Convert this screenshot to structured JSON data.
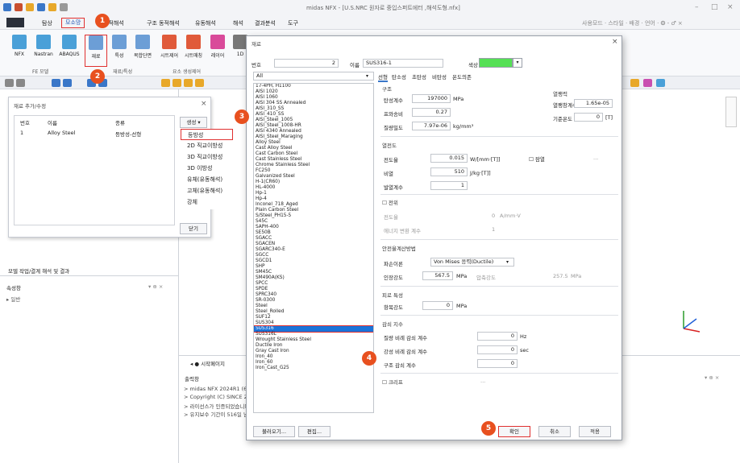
{
  "app": {
    "title": "midas NFX - [U.S.NRC 원자로 중입스퍼트에터 ,해석도형.nfx]",
    "right_tools": "사용모드 · 스타일 · 배경 · 언어 · ❂ - ♂ ×"
  },
  "menu": [
    "탐상",
    "모소망",
    "정적해석",
    "구조 동적해석",
    "유동해석",
    "해석",
    "결과분석",
    "도구"
  ],
  "ribbon": {
    "buttons": [
      "NFX",
      "Nastran",
      "ABAQUS",
      "재료",
      "특성",
      "복합단면",
      "시트제어",
      "시트매칭",
      "레이어",
      "1D"
    ],
    "groups": [
      "FE 모델",
      "재료/특성",
      "요소 생성제어"
    ]
  },
  "markers": [
    "1",
    "2",
    "3",
    "4",
    "5"
  ],
  "matwin": {
    "title": "재료 추가/수정",
    "headers": [
      "번호",
      "이름",
      "종류"
    ],
    "row": {
      "no": "1",
      "name": "Alloy Steel",
      "kind": "등방성-선형"
    },
    "create_btn": "생성",
    "close_btn": "닫기"
  },
  "create_menu": [
    "등방성",
    "2D 직교이방성",
    "3D 직교이방성",
    "3D 이방성",
    "유체(유동해석)",
    "고체(유동해석)",
    "강체"
  ],
  "left_tabs": "모델  작업/결계  해석 및 결과",
  "prop_panel": {
    "title": "속성창",
    "item": "일반"
  },
  "bottom": {
    "tab": "시작페이지",
    "output_title": "출력창",
    "lines": [
      "> midas NFX 2024R1 (64bi",
      "> Copyright (C) SINCE 200",
      "> 라이선스가 인증되었습니다",
      "> 유지보수 기간이 516일 남"
    ]
  },
  "dlg": {
    "title": "재료",
    "no_label": "번호",
    "no": "2",
    "name_label": "이름",
    "name": "SUS316-1",
    "color_label": "색상",
    "color": "#55e055",
    "filter": "All",
    "tabs": [
      "선형",
      "탄소성",
      "초탄성",
      "비탄성",
      "온도의존"
    ],
    "list": [
      "17-4PH, H1100",
      "AISI 1020",
      "AISI 1060",
      "AISI 304 SS Annealed",
      "AISI_310_SS",
      "AISI_410_SS",
      "AISI_Steel_1005",
      "AISI_Steel_1008-HR",
      "AISI 4340 Annealed",
      "AISI_Steel_Maraging",
      "Alloy Steel",
      "Cast Alloy Steel",
      "Cast Carbon Steel",
      "Cast Stainless Steel",
      "Chrome Stainless Steel",
      "FC250",
      "Galvanized Steel",
      "H-1(CR60)",
      "HL-4000",
      "Hp-1",
      "Hp-4",
      "Inconel_718_Aged",
      "Plain Carbon Steel",
      "S/Steel_PH15-5",
      "S45C",
      "SAPH-400",
      "SE50B",
      "SGACC",
      "SGACEN",
      "SGARC340-E",
      "SGCC",
      "SGCD1",
      "SHP",
      "SM45C",
      "SM490A(KS)",
      "SPCC",
      "SPDE",
      "SPRC340",
      "SR-0300",
      "Steel",
      "Steel_Rolled",
      "SUF12",
      "SUS304",
      "SUS316",
      "SUS316L",
      "Wrought Stainless Steel",
      "Ductile Iron",
      "Gray Cast Iron",
      "Iron_40",
      "Iron_60",
      "Iron_Cast_G25"
    ],
    "selected": "SUS316",
    "struct": {
      "title": "구조",
      "e_label": "탄성계수",
      "e": "197000",
      "e_unit": "MPa",
      "nu_label": "프와송비",
      "nu": "0.27",
      "rho_label": "질량밀도",
      "rho": "7.97e-06",
      "rho_unit": "kg/mm³",
      "thermal_title": "열팽력",
      "alpha_label": "열팽창계수",
      "alpha": "1.65e-05",
      "tref_label": "기준온도",
      "tref": "0",
      "tref_unit": "[T]"
    },
    "heat": {
      "title": "열전도",
      "k_label": "전도율",
      "k": "0.015",
      "k_unit": "W/[mm·[T]]",
      "c_label": "비열",
      "c": "510",
      "c_unit": "J/kg·[T]]",
      "h_label": "발열계수",
      "h": "1",
      "latent": "잠열"
    },
    "elec": {
      "title": "전위",
      "cond_label": "전도율",
      "cond": "0",
      "cond_unit": "A/mm·V",
      "coef_label": "에너지 변환 계수",
      "coef": "1"
    },
    "safety": {
      "title": "안전율계산방법",
      "crit_label": "파손이론",
      "crit": "Von Mises 응력(Ductile)",
      "yield_label": "인장강도",
      "yield": "567.5",
      "yield_unit": "MPa",
      "comp_label": "압축강도",
      "comp": "257.5",
      "comp_unit": "MPa"
    },
    "fatigue": {
      "title": "피로 특성",
      "label": "항복강도",
      "value": "0",
      "unit": "MPa"
    },
    "damp": {
      "title": "감쇠 지수",
      "m_label": "질량 비례 감쇠 계수",
      "m": "0",
      "m_unit": "Hz",
      "k_label": "강성 비례 감쇠 계수",
      "k": "0",
      "k_unit": "sec",
      "s_label": "구조 감쇠 계수",
      "s": "0"
    },
    "creep": "크리프",
    "buttons": {
      "load": "불러오기...",
      "edit": "편집...",
      "ok": "확인",
      "cancel": "취소",
      "apply": "적용"
    }
  }
}
